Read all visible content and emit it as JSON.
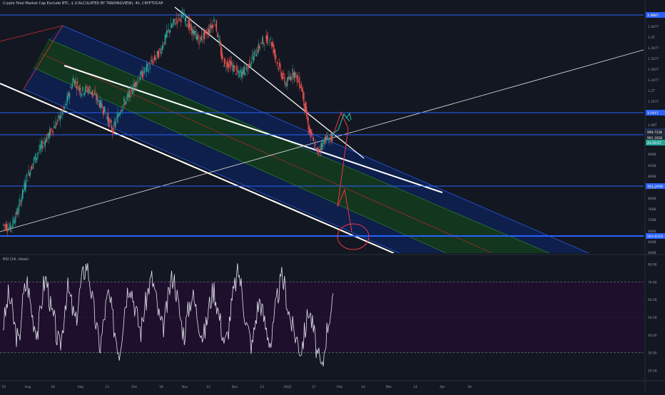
{
  "header": {
    "symbol": "Crypto Total Market Cap Exclude BTC, $ (CALCULATED BY TRADINGVIEW), 4h, CRYPTOCAP"
  },
  "rsi_header": "RSI (14, close)",
  "colors": {
    "background": "#131722",
    "candle_up": "#26a69a",
    "candle_down": "#ef5350",
    "level_line": "#2962ff",
    "channel_outer_fill": "#0d1f4a",
    "channel_inner_fill": "#13361f",
    "channel_border": "#ffffff",
    "trend_line": "#cfcfcf",
    "arrow_red": "#f23645",
    "arrow_green": "#22ab94",
    "rsi_line": "#e0e3eb",
    "rsi_band": "#1e0f2d"
  },
  "chart_data": [
    {
      "type": "candlestick",
      "panel": "price",
      "title": "Crypto Total Market Cap Exclude BTC, $ (CALCULATED BY TRADINGVIEW), 4h, CRYPTOCAP",
      "x_tick_labels": [
        "Aug",
        "16",
        "Sep",
        "13",
        "Oct",
        "18",
        "Nov",
        "15",
        "Dec",
        "13",
        "2022",
        "17",
        "Feb",
        "14",
        "Mar",
        "14",
        "Apr",
        "18"
      ],
      "y_tick_labels": [
        "1.488T",
        "1.447T",
        "1.4T",
        "1.367T",
        "1.327T",
        "1.287T",
        "1.247T",
        "1.2T",
        "1.167T",
        "1.121T",
        "1.08T",
        "960B",
        "920B",
        "880B",
        "840B",
        "800B",
        "760B",
        "720B",
        "680B",
        "640B",
        "600B",
        "560B",
        "520B"
      ],
      "ylim_label": [
        "520B",
        "1.52T"
      ],
      "horizontal_levels": [
        {
          "label": "1.488T",
          "value_B": 1488
        },
        {
          "label": "1.091T",
          "value_B": 1091
        },
        {
          "label": "999.752B",
          "value_B": 999.75
        },
        {
          "label": "791.265B",
          "value_B": 791.265
        },
        {
          "label": "583.831B",
          "value_B": 583.831
        }
      ],
      "price_tags": [
        "999.752B",
        "991.101B",
        "43:00:57"
      ],
      "series_shape": {
        "description": "uptrend from ~640B in late July to ~1.46T peak in early Nov, range 1.2T-1.5T into Dec, decline to ~900B late Jan, last close ~990B",
        "points": [
          [
            "Jul 23",
            640
          ],
          [
            "Jul 28",
            625
          ],
          [
            "Aug 3",
            700
          ],
          [
            "Aug 8",
            820
          ],
          [
            "Aug 13",
            900
          ],
          [
            "Aug 18",
            960
          ],
          [
            "Aug 23",
            1010
          ],
          [
            "Aug 28",
            1060
          ],
          [
            "Sep 2",
            1120
          ],
          [
            "Sep 6",
            1230
          ],
          [
            "Sep 9",
            1180
          ],
          [
            "Sep 13",
            1190
          ],
          [
            "Sep 18",
            1150
          ],
          [
            "Sep 23",
            1100
          ],
          [
            "Sep 28",
            1020
          ],
          [
            "Oct 3",
            1110
          ],
          [
            "Oct 8",
            1160
          ],
          [
            "Oct 13",
            1220
          ],
          [
            "Oct 18",
            1260
          ],
          [
            "Oct 23",
            1300
          ],
          [
            "Oct 28",
            1340
          ],
          [
            "Nov 2",
            1420
          ],
          [
            "Nov 6",
            1470
          ],
          [
            "Nov 10",
            1490
          ],
          [
            "Nov 15",
            1430
          ],
          [
            "Nov 20",
            1390
          ],
          [
            "Nov 26",
            1420
          ],
          [
            "Dec 1",
            1470
          ],
          [
            "Dec 4",
            1300
          ],
          [
            "Dec 9",
            1290
          ],
          [
            "Dec 13",
            1250
          ],
          [
            "Dec 18",
            1270
          ],
          [
            "Dec 23",
            1330
          ],
          [
            "Dec 28",
            1380
          ],
          [
            "Jan 2",
            1400
          ],
          [
            "Jan 5",
            1290
          ],
          [
            "Jan 10",
            1210
          ],
          [
            "Jan 14",
            1260
          ],
          [
            "Jan 18",
            1200
          ],
          [
            "Jan 21",
            1020
          ],
          [
            "Jan 24",
            930
          ],
          [
            "Jan 27",
            985
          ],
          [
            "Jan 29",
            992
          ]
        ]
      }
    },
    {
      "type": "line",
      "panel": "rsi",
      "title": "RSI (14, close)",
      "y_tick_labels": [
        "80.00",
        "70.00",
        "60.00",
        "50.00",
        "40.00",
        "30.00",
        "20.00"
      ],
      "ylim": [
        15,
        85
      ],
      "bands": [
        30,
        70
      ],
      "series": [
        {
          "values": [
            45,
            52,
            62,
            58,
            48,
            40,
            35,
            55,
            65,
            70,
            60,
            50,
            45,
            42,
            55,
            68,
            72,
            63,
            52,
            48,
            38,
            33,
            42,
            58,
            66,
            60,
            52,
            47,
            60,
            70,
            76,
            80,
            72,
            60,
            50,
            40,
            33,
            45,
            56,
            63,
            55,
            45,
            38,
            30,
            42,
            56,
            65,
            70,
            62,
            55,
            47,
            42,
            52,
            60,
            68,
            72,
            66,
            56,
            48,
            43,
            50,
            60,
            70,
            74,
            65,
            55,
            46,
            40,
            50,
            58,
            63,
            57,
            50,
            44,
            38,
            45,
            55,
            62,
            66,
            58,
            50,
            42,
            35,
            40,
            52,
            62,
            70,
            76,
            68,
            56,
            46,
            40,
            33,
            45,
            55,
            60,
            52,
            45,
            40,
            35,
            45,
            58,
            66,
            72,
            68,
            58,
            50,
            44,
            40,
            36,
            31,
            38,
            46,
            55,
            48,
            40,
            30,
            24,
            20,
            36,
            46,
            54,
            58
          ]
        }
      ]
    }
  ]
}
